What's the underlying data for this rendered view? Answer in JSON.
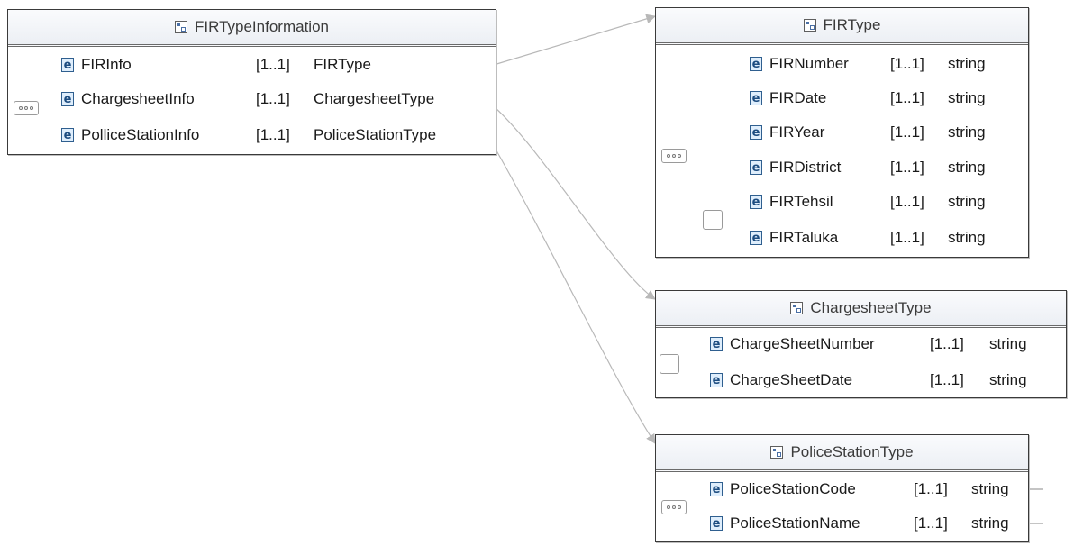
{
  "colors": {
    "border": "#3a3a3a",
    "connector": "#b8b8b8",
    "element_icon": "#2f5f8f"
  },
  "main_type": {
    "name": "FIRTypeInformation",
    "rows": [
      {
        "name": "FIRInfo",
        "card": "[1..1]",
        "type": "FIRType"
      },
      {
        "name": "ChargesheetInfo",
        "card": "[1..1]",
        "type": "ChargesheetType"
      },
      {
        "name": "PolliceStationInfo",
        "card": "[1..1]",
        "type": "PoliceStationType"
      }
    ]
  },
  "fir_type": {
    "name": "FIRType",
    "rows": [
      {
        "name": "FIRNumber",
        "card": "[1..1]",
        "type": "string"
      },
      {
        "name": "FIRDate",
        "card": "[1..1]",
        "type": "string"
      },
      {
        "name": "FIRYear",
        "card": "[1..1]",
        "type": "string"
      },
      {
        "name": "FIRDistrict",
        "card": "[1..1]",
        "type": "string"
      },
      {
        "name": "FIRTehsil",
        "card": "[1..1]",
        "type": "string"
      },
      {
        "name": "FIRTaluka",
        "card": "[1..1]",
        "type": "string"
      }
    ]
  },
  "chargesheet_type": {
    "name": "ChargesheetType",
    "rows": [
      {
        "name": "ChargeSheetNumber",
        "card": "[1..1]",
        "type": "string"
      },
      {
        "name": "ChargeSheetDate",
        "card": "[1..1]",
        "type": "string"
      }
    ]
  },
  "police_station_type": {
    "name": "PoliceStationType",
    "rows": [
      {
        "name": "PoliceStationCode",
        "card": "[1..1]",
        "type": "string"
      },
      {
        "name": "PoliceStationName",
        "card": "[1..1]",
        "type": "string"
      }
    ]
  },
  "icons": {
    "element": "e",
    "type": "complex-type-icon",
    "sequence": "sequence-compositor-icon",
    "choice": "choice-compositor-icon"
  }
}
